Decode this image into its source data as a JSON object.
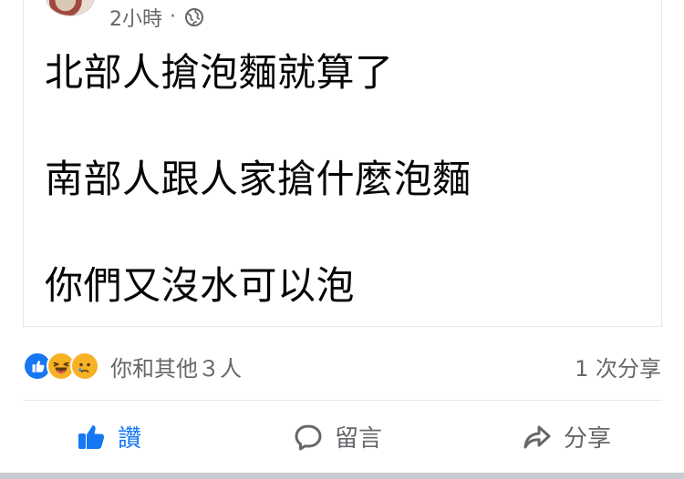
{
  "post": {
    "time": "2小時",
    "dot": "·",
    "lines": [
      "北部人搶泡麵就算了",
      "南部人跟人家搶什麼泡麵",
      "你們又沒水可以泡"
    ]
  },
  "summary": {
    "reactions_text": "你和其他３人",
    "shares_text": "1 次分享",
    "reaction_icons": [
      "like-reaction-icon",
      "laugh-reaction-icon",
      "sad-reaction-icon"
    ]
  },
  "actions": {
    "like_label": "讚",
    "comment_label": "留言",
    "share_label": "分享"
  },
  "colors": {
    "accent": "#1877f2",
    "muted_text": "#65676b",
    "divider": "#e4e6eb"
  },
  "icons": {
    "privacy": "globe-icon",
    "like": "thumbs-up-icon",
    "comment": "comment-bubble-icon",
    "share": "share-arrow-icon"
  }
}
